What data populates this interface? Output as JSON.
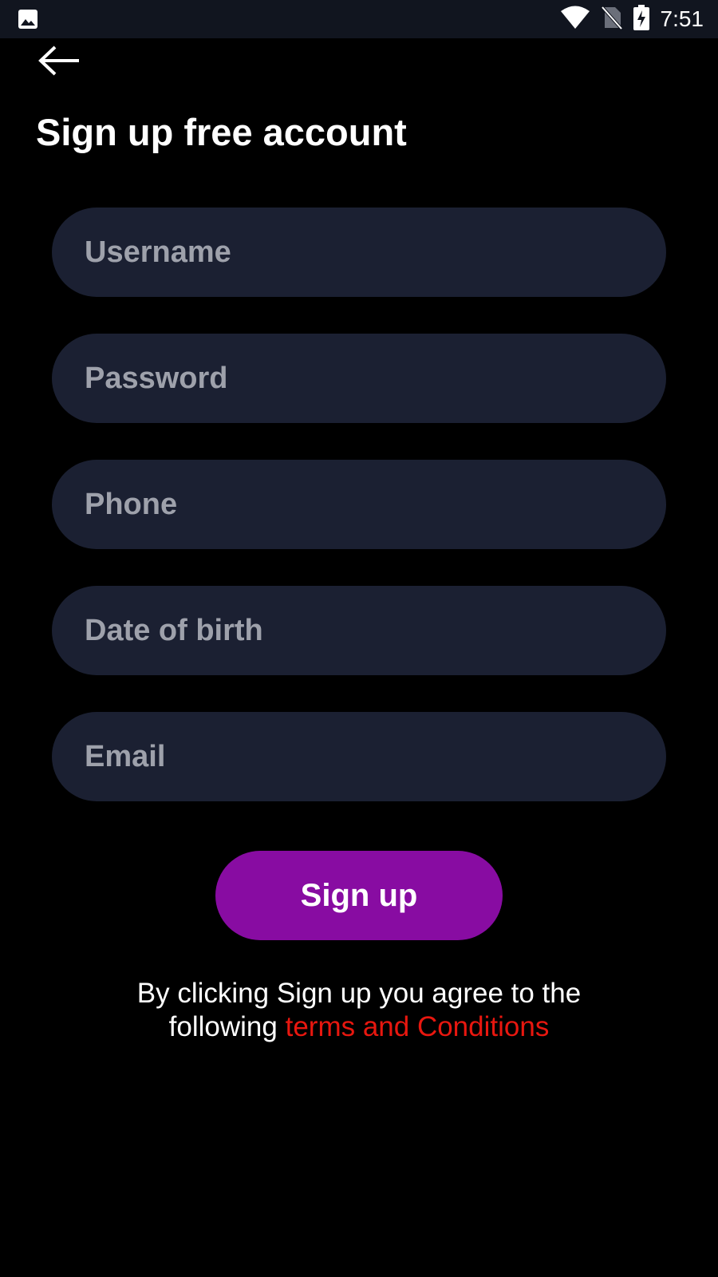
{
  "status_bar": {
    "time": "7:51",
    "icons": [
      "image-icon",
      "wifi-icon",
      "no-sim-icon",
      "battery-charging-icon"
    ]
  },
  "header": {
    "back_icon": "arrow-left-icon",
    "title": "Sign up free account"
  },
  "form": {
    "username_placeholder": "Username",
    "password_placeholder": "Password",
    "phone_placeholder": "Phone",
    "dob_placeholder": "Date of birth",
    "email_placeholder": "Email",
    "username_value": "",
    "password_value": "",
    "phone_value": "",
    "dob_value": "",
    "email_value": ""
  },
  "actions": {
    "signup_label": "Sign up"
  },
  "terms": {
    "line1": "By clicking Sign up you agree to the",
    "line2_prefix": "following ",
    "link_text": "terms and Conditions"
  },
  "colors": {
    "background": "#000000",
    "field_background": "#1b2032",
    "placeholder": "#9ea1ab",
    "button": "#880ca2",
    "link": "#e8170f",
    "status_bar": "#11151f"
  }
}
